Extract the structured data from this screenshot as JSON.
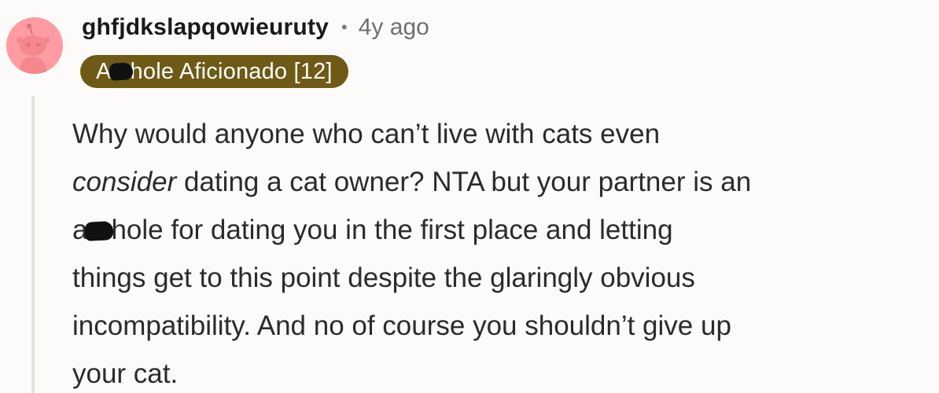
{
  "comment": {
    "username": "ghfjdkslapqowieuruty",
    "separator": "•",
    "age": "4y ago",
    "flair": {
      "prefix": "A",
      "suffix": "hole Aficionado [12]"
    },
    "body": {
      "line1": "Why would anyone who can’t live with cats even",
      "line2_em": "consider",
      "line2_rest": " dating a cat owner? NTA but your partner is an",
      "line3_prefix": "a",
      "line3_rest": "hole for dating you in the first place and letting",
      "line4": "things get to this point despite the glaringly obvious",
      "line5": "incompatibility. And no of course you shouldn’t give up",
      "line6": "your cat."
    }
  },
  "colors": {
    "avatar_bg": "#ff9ba3",
    "flair_bg": "#6e5a16",
    "thread_line": "#e4e1dc"
  },
  "icons": {
    "avatar": "snoo-avatar-icon",
    "censor": "censor-blob-icon"
  }
}
